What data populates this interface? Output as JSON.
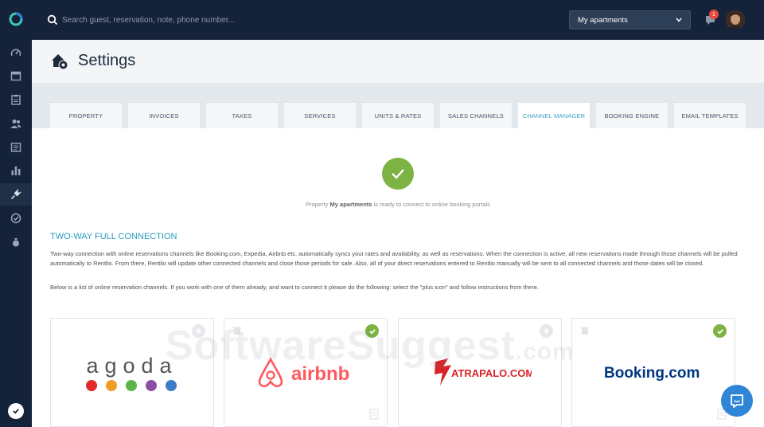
{
  "search": {
    "placeholder": "Search guest, reservation, note, phone number..."
  },
  "topbar": {
    "property_select": "My apartments",
    "notification_count": "1"
  },
  "header": {
    "title": "Settings"
  },
  "tabs": [
    {
      "label": "PROPERTY"
    },
    {
      "label": "INVOICES"
    },
    {
      "label": "TAXES"
    },
    {
      "label": "SERVICES"
    },
    {
      "label": "UNITS & RATES"
    },
    {
      "label": "SALES CHANNELS"
    },
    {
      "label": "CHANNEL MANAGER",
      "active": true
    },
    {
      "label": "BOOKING ENGINE"
    },
    {
      "label": "EMAIL TEMPLATES"
    }
  ],
  "status": {
    "prefix": "Property",
    "property_name": "My apartments",
    "suffix": "is ready to connect to online booking portals"
  },
  "section": {
    "title": "TWO-WAY FULL CONNECTION",
    "paragraph1": "Two-way connection with online reservations channels like Booking.com, Expedia, Airbnb etc. automatically syncs your rates and availability, as well as reservations. When the connection is active, all new reservations made through those channels will be pulled automatically to Rentlio. From there, Rentlio will update other connected channels and close those periods for sale. Also, all of your direct reservations entered to Rentlio manually will be sent to all connected channels and those dates will be closed.",
    "paragraph2": "Below is a list of online reservation channels. If you work with one of them already, and want to connect it please do the following: select the \"plus icon\" and follow instructions from there."
  },
  "channels": [
    {
      "name": "agoda",
      "state": "add"
    },
    {
      "name": "airbnb",
      "state": "connected"
    },
    {
      "name": "ATRAPALO.COM",
      "state": "add"
    },
    {
      "name": "Booking.com",
      "state": "connected"
    }
  ],
  "watermark": {
    "text": "SoftwareSuggest",
    "suffix": ".com"
  },
  "colors": {
    "sidebar": "#15233a",
    "accent": "#2a9bc0",
    "success": "#7cb342",
    "airbnb": "#ff5a5f",
    "booking": "#003580",
    "atrapalo": "#d8232a"
  }
}
